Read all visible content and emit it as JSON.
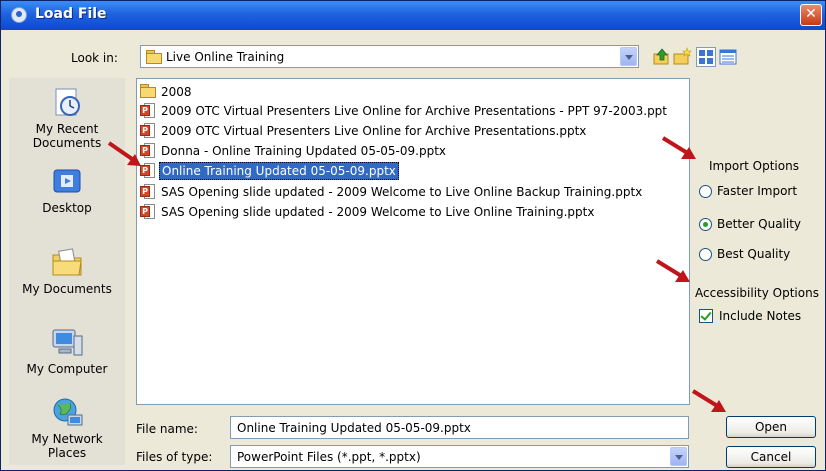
{
  "window": {
    "title": "Load File",
    "close_glyph": "✕"
  },
  "look_in": {
    "label": "Look in:",
    "value": "Live Online Training"
  },
  "places": [
    {
      "label_lines": [
        "My Recent",
        "Documents"
      ],
      "icon": "recent-documents-icon"
    },
    {
      "label_lines": [
        "Desktop"
      ],
      "icon": "desktop-icon"
    },
    {
      "label_lines": [
        "My Documents"
      ],
      "icon": "my-documents-icon"
    },
    {
      "label_lines": [
        "My Computer"
      ],
      "icon": "my-computer-icon"
    },
    {
      "label_lines": [
        "My Network",
        "Places"
      ],
      "icon": "network-places-icon"
    }
  ],
  "files": [
    {
      "name": "2008",
      "type": "folder"
    },
    {
      "name": "2009 OTC Virtual Presenters Live Online for Archive Presentations - PPT 97-2003.ppt",
      "type": "ppt"
    },
    {
      "name": "2009 OTC Virtual Presenters Live Online for Archive Presentations.pptx",
      "type": "pptx"
    },
    {
      "name": "Donna - Online Training Updated 05-05-09.pptx",
      "type": "pptx"
    },
    {
      "name": "Online Training Updated 05-05-09.pptx",
      "type": "pptx",
      "selected": true
    },
    {
      "name": "SAS Opening slide updated - 2009 Welcome to Live Online Backup Training.pptx",
      "type": "pptx"
    },
    {
      "name": "SAS Opening slide updated - 2009 Welcome to Live Online Training.pptx",
      "type": "pptx"
    }
  ],
  "file_name": {
    "label": "File name:",
    "value": "Online Training Updated 05-05-09.pptx"
  },
  "file_type": {
    "label": "Files of type:",
    "value": "PowerPoint Files (*.ppt, *.pptx)"
  },
  "import_options": {
    "heading": "Import Options",
    "options": [
      {
        "label": "Faster Import",
        "checked": false
      },
      {
        "label": "Better Quality",
        "checked": true
      },
      {
        "label": "Best Quality",
        "checked": false
      }
    ]
  },
  "accessibility": {
    "heading": "Accessibility Options",
    "include_notes_label": "Include Notes",
    "include_notes_checked": true
  },
  "buttons": {
    "open": "Open",
    "cancel": "Cancel"
  },
  "colors": {
    "title_bar": "#0b4bd0",
    "selection": "#316ac5",
    "annotation_arrow": "#c0151a",
    "dialog_bg": "#ece9d8"
  }
}
